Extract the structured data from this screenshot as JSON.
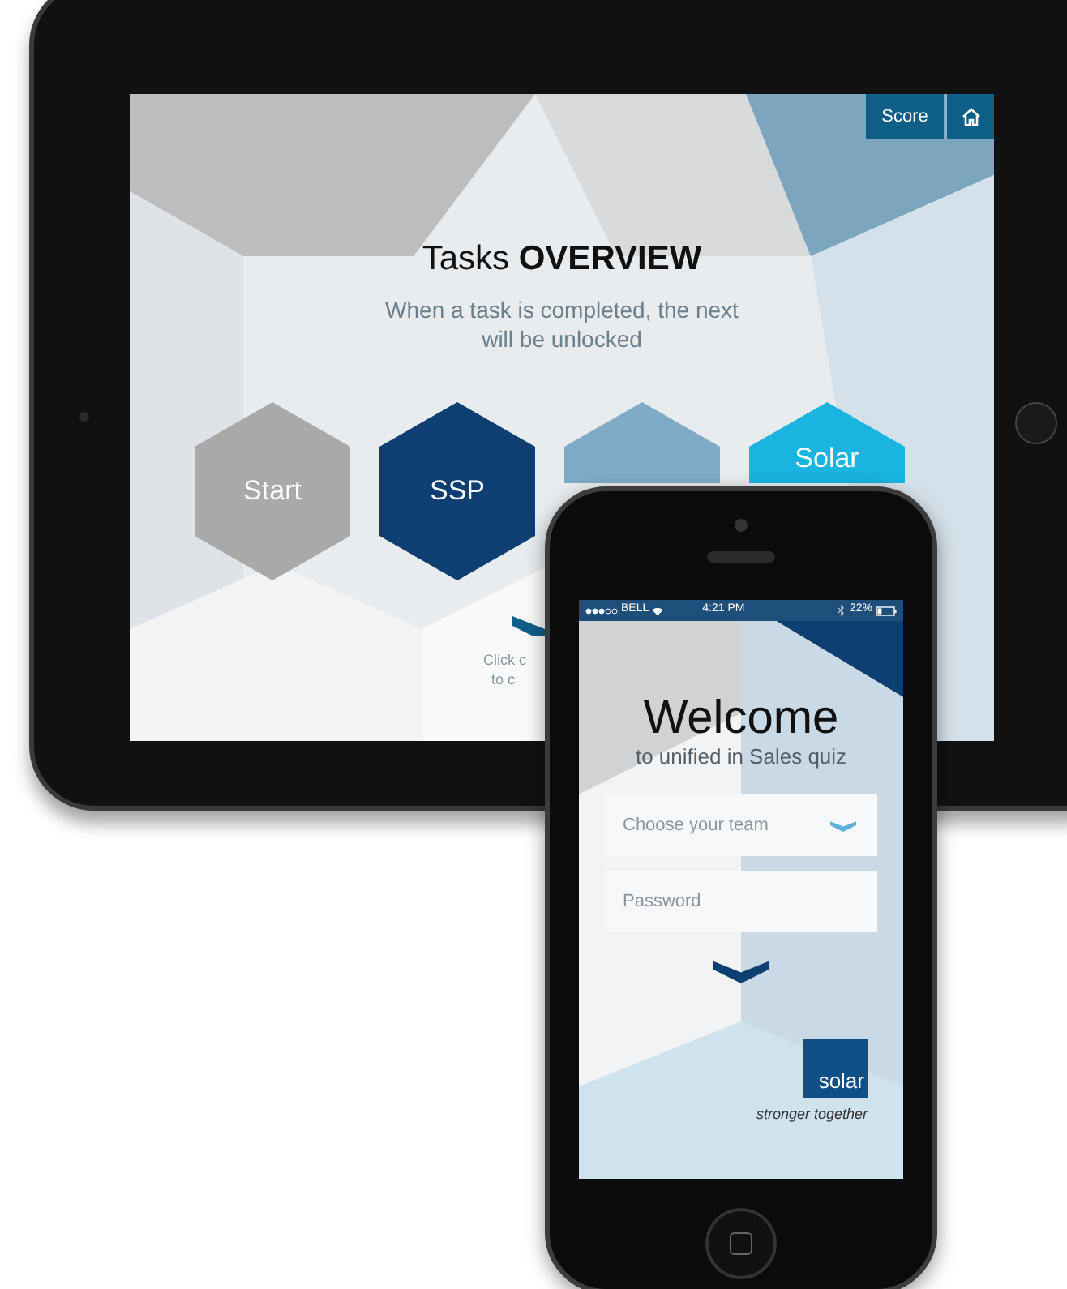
{
  "tablet": {
    "score_button": {
      "label": "Score"
    },
    "title": "Tasks **OVERVIEW**",
    "subtitle": "When a task is completed, the next will be unlocked",
    "tasks": [
      {
        "label": "Start",
        "color": "#a9a9a9"
      },
      {
        "label": "SSP",
        "color": "#0d3f73"
      },
      {
        "color": "#7fabc6"
      },
      {
        "label": "Solar",
        "color": "#19b4e0"
      }
    ],
    "hint": [
      "Click c",
      "to c"
    ]
  },
  "phone": {
    "status_bar": {
      "carrier": "BELL",
      "time": "4:21 PM",
      "battery": "22%"
    },
    "title": "Welcome",
    "subtitle": "to unified in Sales quiz",
    "team_select": {
      "placeholder": "Choose your team"
    },
    "password": {
      "placeholder": "Password"
    },
    "logo": "solar",
    "tagline": "stronger together"
  }
}
